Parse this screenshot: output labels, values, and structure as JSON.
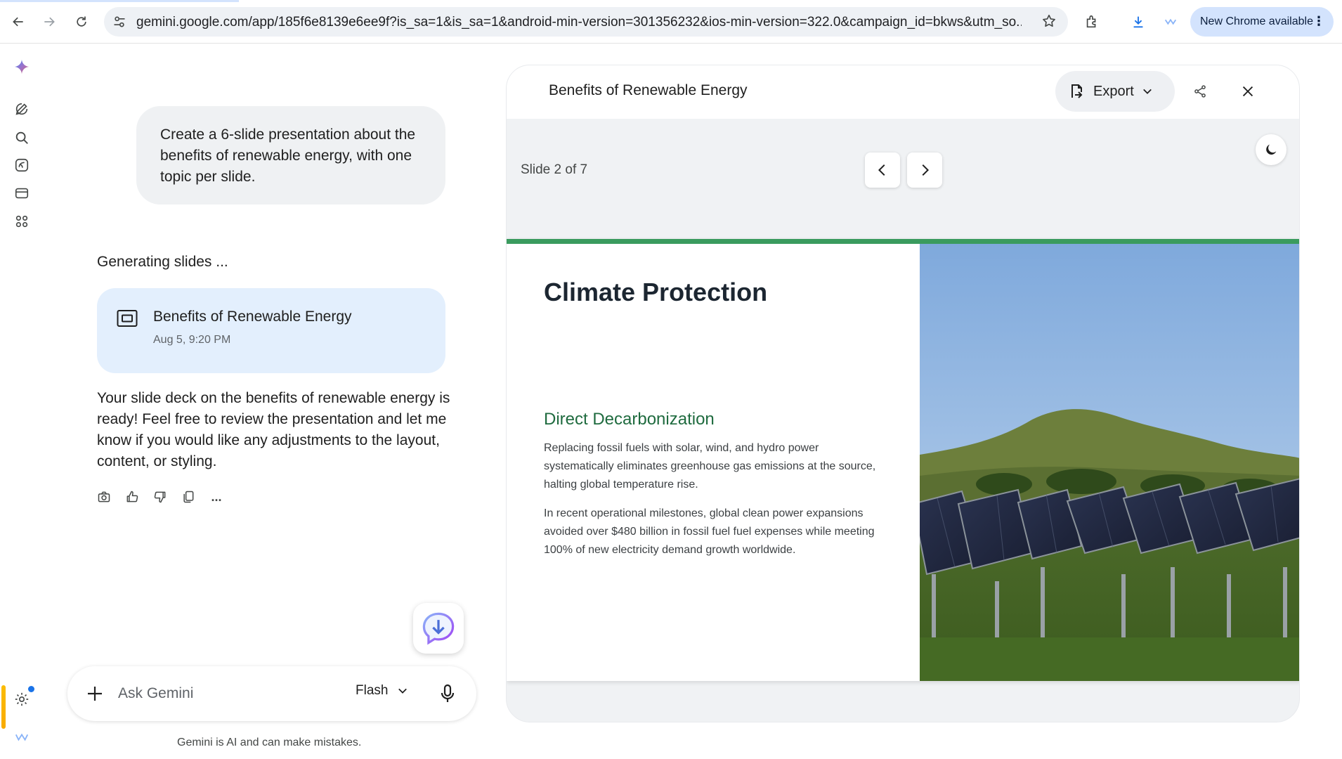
{
  "browser": {
    "url": "gemini.google.com/app/185f6e8139e6ee9f?is_sa=1&is_sa=1&android-min-version=301356232&ios-min-version=322.0&campaign_id=bkws&utm_so...",
    "update_label": "New Chrome available"
  },
  "rail": {
    "icons": [
      "gemini-sparkle-icon",
      "new-chat-icon",
      "search-icon",
      "gems-icon",
      "library-icon",
      "apps-icon",
      "settings-icon"
    ]
  },
  "chat": {
    "user_prompt": "Create a 6-slide presentation about the benefits of renewable energy, with one topic per slide.",
    "status": "Generating slides ...",
    "deck_card": {
      "title": "Benefits of Renewable Energy",
      "date": "Aug 5, 9:20 PM"
    },
    "response": "Your slide deck on the benefits of renewable energy is ready! Feel free to review the presentation and let me know if you would like any adjustments to the layout, content, or styling.",
    "actions": [
      "camera-icon",
      "thumbs-up-icon",
      "thumbs-down-icon",
      "copy-icon",
      "more-icon"
    ],
    "more_label": "..."
  },
  "composer": {
    "placeholder": "Ask Gemini",
    "model": "Flash",
    "disclaimer": "Gemini is AI and can make mistakes."
  },
  "canvas": {
    "title": "Benefits of Renewable Energy",
    "export_label": "Export",
    "slide_counter": "Slide 2 of 7",
    "slide": {
      "heading": "Climate Protection",
      "subheading": "Direct Decarbonization",
      "paragraph1": "Replacing fossil fuels with solar, wind, and hydro power systematically eliminates greenhouse gas emissions at the source, halting global temperature rise.",
      "paragraph2": "In recent operational milestones, global clean power expansions avoided over $480 billion in fossil fuel fuel expenses while meeting 100% of new electricity demand growth worldwide."
    }
  },
  "colors": {
    "accent_green": "#3a9b5e",
    "subheading_green": "#1f6b3f",
    "deck_card_bg": "#e3effd",
    "user_bubble_bg": "#eff1f3"
  }
}
